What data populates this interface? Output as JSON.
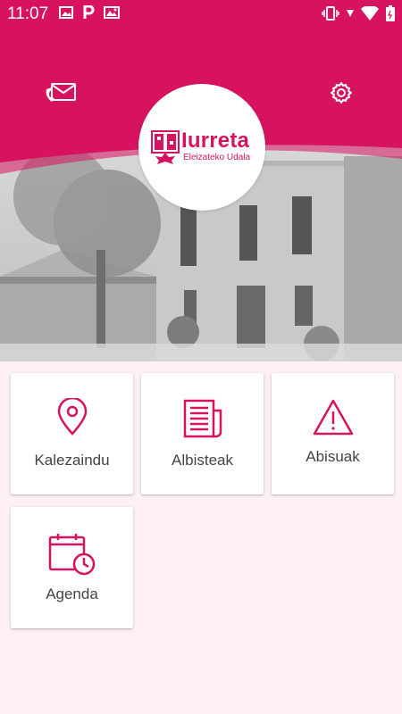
{
  "status_bar": {
    "time": "11:07",
    "left_icons": [
      "image-icon",
      "parking-icon",
      "photo-icon"
    ],
    "right_icons": [
      "vibrate-icon",
      "signal-icon",
      "wifi-icon",
      "battery-icon"
    ]
  },
  "header": {
    "contact_icon": "mail-phone-icon",
    "settings_icon": "gear-icon",
    "logo": {
      "title": "Iurreta",
      "subtitle": "Eleizateko Udala"
    }
  },
  "colors": {
    "brand": "#d7135f",
    "background": "#fdf1f5",
    "card_label": "#444444"
  },
  "menu": {
    "items": [
      {
        "label": "Kalezaindu",
        "icon": "location-pin-icon"
      },
      {
        "label": "Albisteak",
        "icon": "newspaper-icon"
      },
      {
        "label": "Abisuak",
        "icon": "warning-icon"
      },
      {
        "label": "Agenda",
        "icon": "calendar-clock-icon"
      }
    ]
  }
}
